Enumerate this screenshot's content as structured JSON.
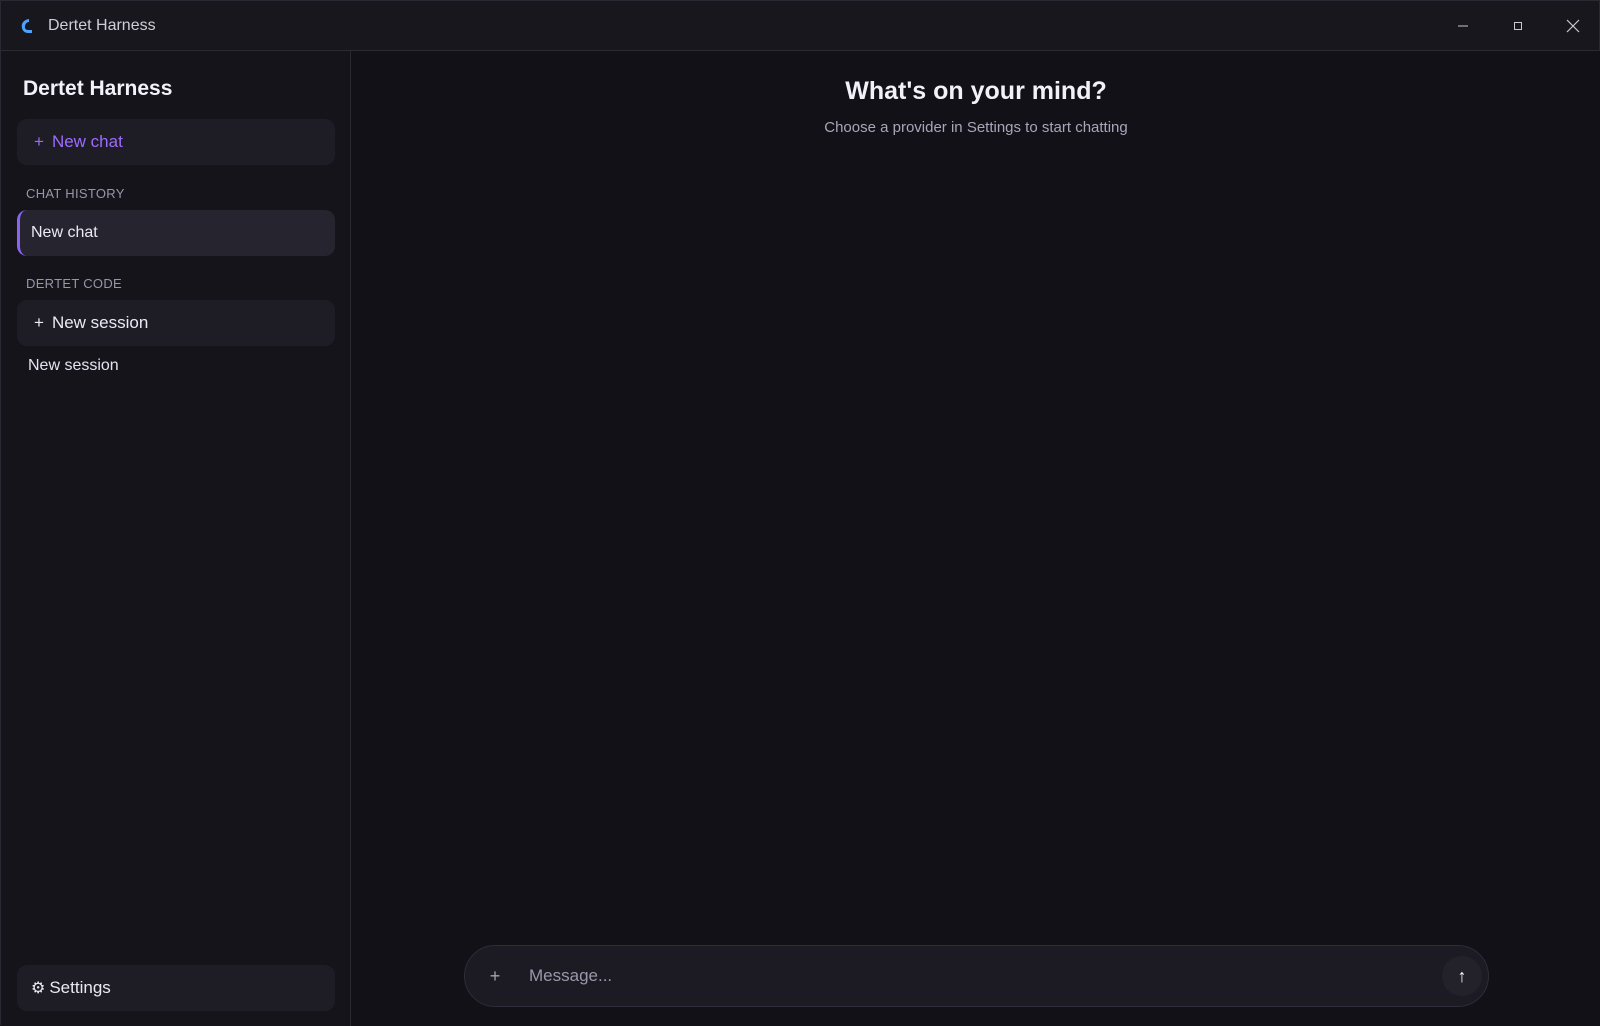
{
  "window": {
    "title": "Dertet Harness",
    "minimize_icon": "minimize-icon",
    "maximize_icon": "maximize-icon",
    "close_icon": "close-icon"
  },
  "sidebar": {
    "brand": "Dertet Harness",
    "new_chat": {
      "icon": "+",
      "label": "New chat"
    },
    "chat_history": {
      "heading": "CHAT HISTORY",
      "items": [
        {
          "label": "New chat",
          "active": true
        }
      ]
    },
    "code": {
      "heading": "DERTET CODE",
      "new_session": {
        "icon": "+",
        "label": "New session"
      },
      "items": [
        {
          "label": "New session"
        }
      ]
    },
    "settings": {
      "icon": "⚙",
      "label": "Settings"
    }
  },
  "main": {
    "headline": "What's on your mind?",
    "subline": "Choose a provider in Settings to start chatting",
    "composer": {
      "attach_icon": "+",
      "placeholder": "Message...",
      "value": "",
      "send_icon": "↑"
    }
  },
  "colors": {
    "accent": "#9d6bff",
    "active_border": "#8a63f0",
    "background": "#121118",
    "sidebar": "#15141b"
  }
}
